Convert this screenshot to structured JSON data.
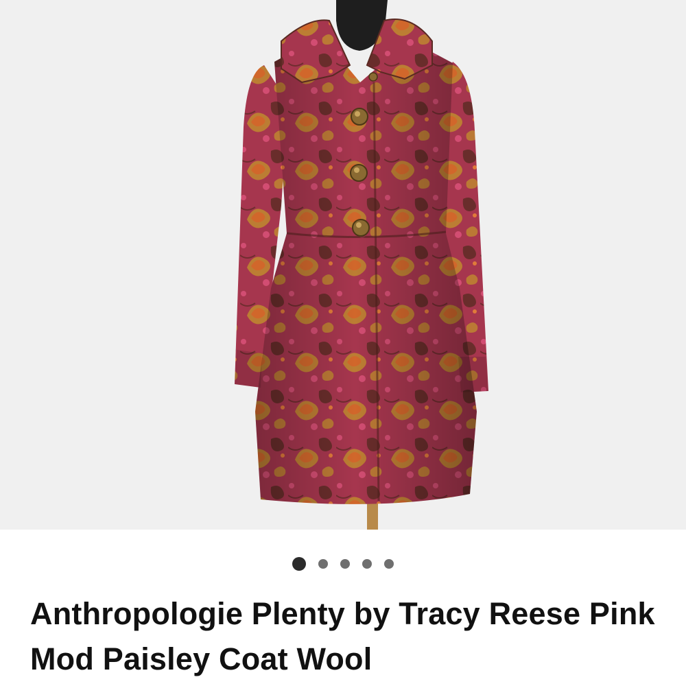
{
  "listing": {
    "title": "Anthropologie Plenty by Tracy Reese Pink Mod Paisley Coat Wool",
    "image": {
      "subject": "paisley-wool-coat-on-mannequin",
      "background_color": "#f0f0f0"
    }
  },
  "gallery": {
    "total": 5,
    "active_index": 0,
    "dots": [
      {
        "state": "active"
      },
      {
        "state": "inactive"
      },
      {
        "state": "inactive"
      },
      {
        "state": "inactive"
      },
      {
        "state": "inactive"
      }
    ]
  },
  "colors": {
    "coat_base": "#a6364e",
    "coat_pink": "#d24d72",
    "paisley_gold": "#c08a2e",
    "paisley_orange": "#d4652a",
    "paisley_brown": "#5a2a22",
    "button_brass": "#8a6a32",
    "mannequin": "#1e1e1e",
    "stand_wood": "#b88a4a",
    "dot_active": "#2b2b2b",
    "dot_inactive": "#6f6f6f"
  }
}
